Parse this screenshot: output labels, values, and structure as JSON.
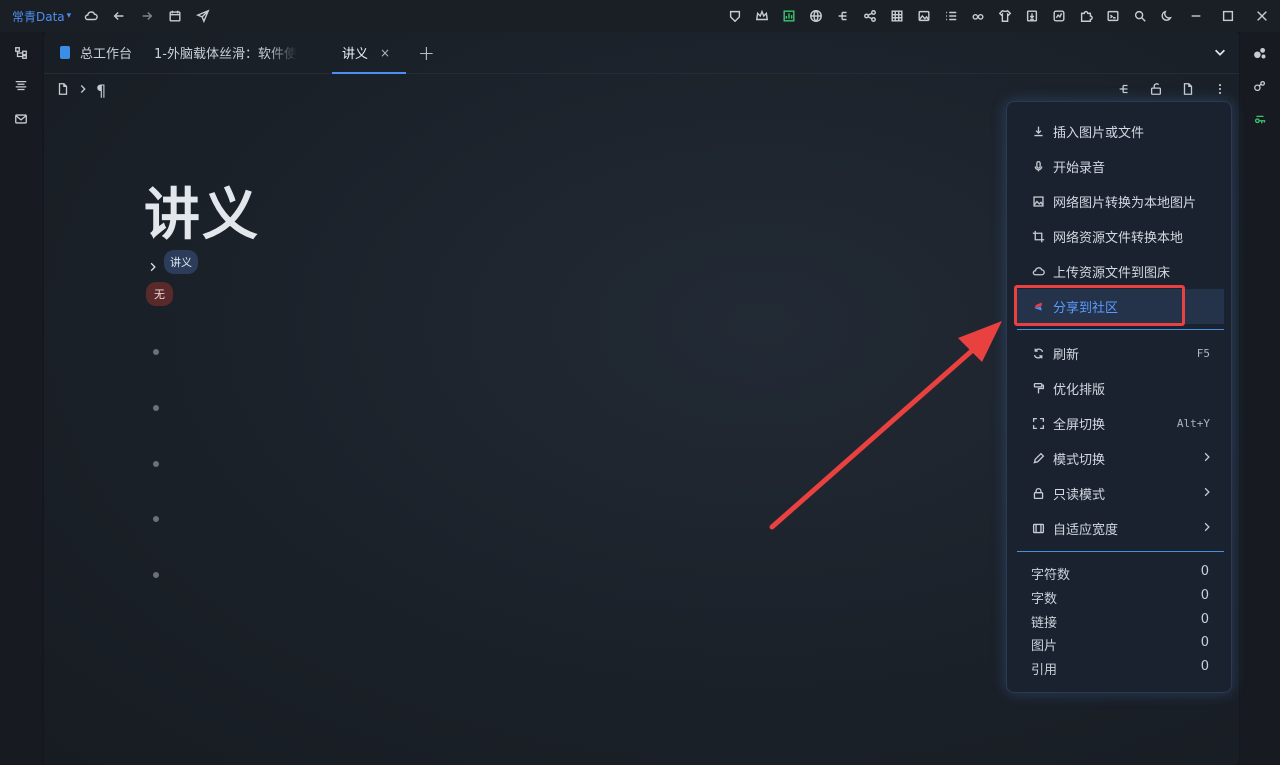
{
  "topbar": {
    "workspace": "常青Data"
  },
  "tabs": [
    {
      "label": "总工作台"
    },
    {
      "label": "1-外脑载体丝滑：软件使"
    },
    {
      "label": "讲义"
    }
  ],
  "breadcrumb": {
    "paragraph_symbol": "¶"
  },
  "document": {
    "title": "讲义",
    "tag_primary": "讲义",
    "tag_secondary": "无"
  },
  "menu": {
    "items": [
      {
        "label": "插入图片或文件",
        "icon": "download-icon"
      },
      {
        "label": "开始录音",
        "icon": "microphone-icon"
      },
      {
        "label": "网络图片转换为本地图片",
        "icon": "image-icon"
      },
      {
        "label": "网络资源文件转换本地",
        "icon": "crop-icon"
      },
      {
        "label": "上传资源文件到图床",
        "icon": "cloud-icon"
      },
      {
        "label": "分享到社区",
        "icon": "community-icon",
        "highlight": true
      },
      {
        "label": "刷新",
        "shortcut": "F5",
        "icon": "refresh-icon"
      },
      {
        "label": "优化排版",
        "icon": "paint-roller-icon"
      },
      {
        "label": "全屏切换",
        "shortcut": "Alt+Y",
        "icon": "fullscreen-icon"
      },
      {
        "label": "模式切换",
        "icon": "pencil-icon",
        "submenu": true
      },
      {
        "label": "只读模式",
        "icon": "lock-icon",
        "submenu": true
      },
      {
        "label": "自适应宽度",
        "icon": "width-icon",
        "submenu": true
      }
    ],
    "stats": [
      {
        "label": "字符数",
        "value": "0"
      },
      {
        "label": "字数",
        "value": "0"
      },
      {
        "label": "链接",
        "value": "0"
      },
      {
        "label": "图片",
        "value": "0"
      },
      {
        "label": "引用",
        "value": "0"
      }
    ]
  },
  "colors": {
    "accent": "#4d8ff0",
    "annotation_red": "#e94040",
    "background": "#1b2129"
  }
}
